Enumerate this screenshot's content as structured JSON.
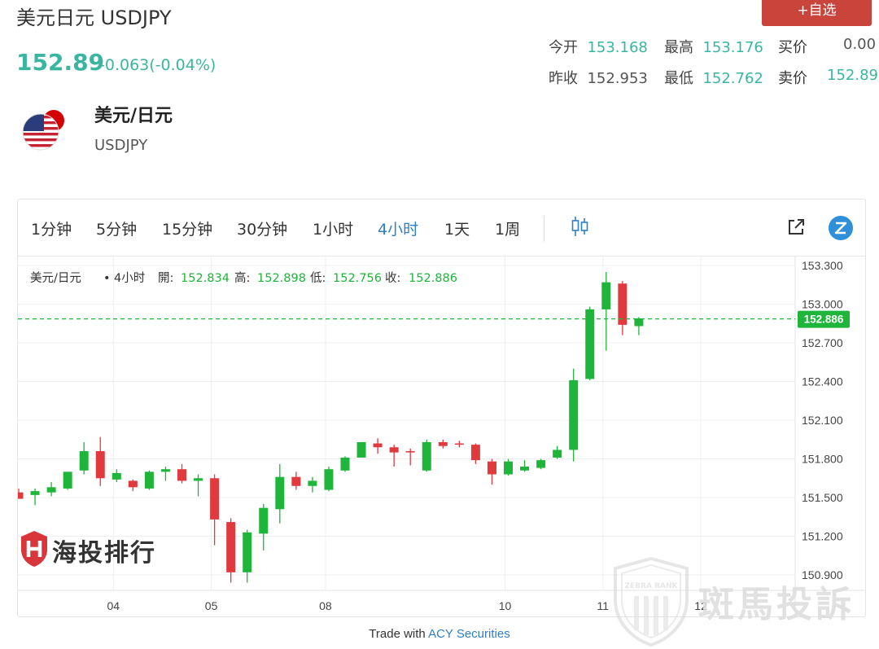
{
  "header": {
    "title": "美元日元 USDJPY",
    "add_button": "+自选",
    "price": "152.89",
    "change": "-0.063(-0.04%)"
  },
  "stats": {
    "open_label": "今开",
    "open": "153.168",
    "high_label": "最高",
    "high": "153.176",
    "bid_label": "买价",
    "bid": "0.00",
    "prev_close_label": "昨收",
    "prev_close": "152.953",
    "low_label": "最低",
    "low": "152.762",
    "ask_label": "卖价",
    "ask": "152.89"
  },
  "instrument": {
    "name": "美元/日元",
    "code": "USDJPY",
    "flag_icon": "us-jp-flag-icon"
  },
  "toolbar": {
    "timeframes": [
      "1分钟",
      "5分钟",
      "15分钟",
      "30分钟",
      "1小时",
      "4小时",
      "1天",
      "1周"
    ],
    "active": "4小时"
  },
  "legend": {
    "name": "美元/日元",
    "sep": "•",
    "interval": "4小时",
    "open_label": "開:",
    "open": "152.834",
    "high_label": "高:",
    "high": "152.898",
    "low_label": "低:",
    "low": "152.756",
    "close_label": "收:",
    "close": "152.886"
  },
  "colors": {
    "up": "#1fb53a",
    "down": "#e0393e",
    "accent": "#2f7fc8",
    "price_green": "#3ab6a0"
  },
  "chart_data": {
    "type": "candlestick",
    "interval": "4小时",
    "ylim": [
      150.78,
      153.37
    ],
    "yticks": [
      "153.300",
      "153.000",
      "152.700",
      "152.400",
      "152.100",
      "151.800",
      "151.500",
      "151.200",
      "150.900"
    ],
    "xticks": [
      {
        "label": "04",
        "index": 5.8
      },
      {
        "label": "05",
        "index": 11.8
      },
      {
        "label": "08",
        "index": 18.8
      },
      {
        "label": "10",
        "index": 29.8
      },
      {
        "label": "11",
        "index": 35.8
      },
      {
        "label": "12",
        "index": 41.8
      }
    ],
    "current_price": "152.886",
    "current_value": 152.886,
    "candles": [
      {
        "o": 151.54,
        "h": 151.57,
        "l": 151.5,
        "c": 151.49
      },
      {
        "o": 151.52,
        "h": 151.57,
        "l": 151.44,
        "c": 151.55
      },
      {
        "o": 151.54,
        "h": 151.62,
        "l": 151.51,
        "c": 151.58
      },
      {
        "o": 151.57,
        "h": 151.68,
        "l": 151.56,
        "c": 151.7
      },
      {
        "o": 151.71,
        "h": 151.93,
        "l": 151.68,
        "c": 151.86
      },
      {
        "o": 151.86,
        "h": 151.97,
        "l": 151.59,
        "c": 151.65
      },
      {
        "o": 151.64,
        "h": 151.72,
        "l": 151.62,
        "c": 151.69
      },
      {
        "o": 151.63,
        "h": 151.64,
        "l": 151.55,
        "c": 151.58
      },
      {
        "o": 151.57,
        "h": 151.71,
        "l": 151.56,
        "c": 151.7
      },
      {
        "o": 151.7,
        "h": 151.74,
        "l": 151.63,
        "c": 151.72
      },
      {
        "o": 151.72,
        "h": 151.76,
        "l": 151.61,
        "c": 151.63
      },
      {
        "o": 151.63,
        "h": 151.68,
        "l": 151.51,
        "c": 151.65
      },
      {
        "o": 151.65,
        "h": 151.68,
        "l": 151.13,
        "c": 151.33
      },
      {
        "o": 151.31,
        "h": 151.34,
        "l": 150.84,
        "c": 150.92
      },
      {
        "o": 150.92,
        "h": 151.25,
        "l": 150.84,
        "c": 151.23
      },
      {
        "o": 151.22,
        "h": 151.45,
        "l": 151.09,
        "c": 151.42
      },
      {
        "o": 151.41,
        "h": 151.76,
        "l": 151.3,
        "c": 151.66
      },
      {
        "o": 151.66,
        "h": 151.7,
        "l": 151.56,
        "c": 151.59
      },
      {
        "o": 151.59,
        "h": 151.66,
        "l": 151.54,
        "c": 151.63
      },
      {
        "o": 151.56,
        "h": 151.74,
        "l": 151.55,
        "c": 151.72
      },
      {
        "o": 151.71,
        "h": 151.82,
        "l": 151.7,
        "c": 151.81
      },
      {
        "o": 151.81,
        "h": 151.92,
        "l": 151.81,
        "c": 151.93
      },
      {
        "o": 151.92,
        "h": 151.96,
        "l": 151.84,
        "c": 151.89
      },
      {
        "o": 151.89,
        "h": 151.91,
        "l": 151.74,
        "c": 151.85
      },
      {
        "o": 151.86,
        "h": 151.88,
        "l": 151.75,
        "c": 151.85
      },
      {
        "o": 151.71,
        "h": 151.95,
        "l": 151.7,
        "c": 151.93
      },
      {
        "o": 151.93,
        "h": 151.95,
        "l": 151.88,
        "c": 151.9
      },
      {
        "o": 151.92,
        "h": 151.94,
        "l": 151.89,
        "c": 151.91
      },
      {
        "o": 151.91,
        "h": 151.92,
        "l": 151.76,
        "c": 151.79
      },
      {
        "o": 151.78,
        "h": 151.8,
        "l": 151.6,
        "c": 151.68
      },
      {
        "o": 151.68,
        "h": 151.8,
        "l": 151.67,
        "c": 151.78
      },
      {
        "o": 151.71,
        "h": 151.79,
        "l": 151.7,
        "c": 151.74
      },
      {
        "o": 151.73,
        "h": 151.8,
        "l": 151.72,
        "c": 151.79
      },
      {
        "o": 151.81,
        "h": 151.9,
        "l": 151.8,
        "c": 151.87
      },
      {
        "o": 151.87,
        "h": 152.5,
        "l": 151.78,
        "c": 152.41
      },
      {
        "o": 152.42,
        "h": 152.98,
        "l": 152.41,
        "c": 152.96
      },
      {
        "o": 152.96,
        "h": 153.25,
        "l": 152.64,
        "c": 153.17
      },
      {
        "o": 153.16,
        "h": 153.18,
        "l": 152.76,
        "c": 152.84
      },
      {
        "o": 152.83,
        "h": 152.9,
        "l": 152.76,
        "c": 152.89
      }
    ]
  },
  "watermarks": {
    "left": "海投排行",
    "right": "斑馬投訴",
    "shield": "ZEBRA RANK"
  },
  "footer": {
    "prefix": "Trade with ",
    "link": "ACY Securities"
  }
}
